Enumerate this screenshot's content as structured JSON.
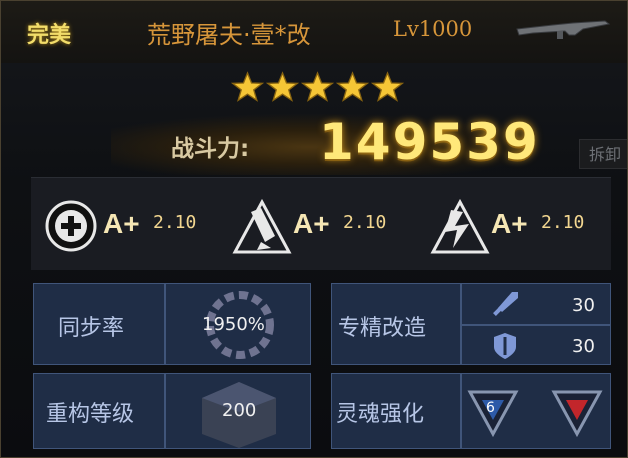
{
  "header": {
    "quality": "完美",
    "item_name": "荒野屠夫·壹*改",
    "level": "Lv1000"
  },
  "stars": {
    "count": 5,
    "max": 5,
    "color": "#f5c636"
  },
  "power": {
    "label": "战斗力:",
    "value": "149539"
  },
  "ghost_button": {
    "label": "拆卸"
  },
  "ratings": [
    {
      "icon": "plus-circle-icon",
      "grade": "A+",
      "value": "2.10"
    },
    {
      "icon": "rocket-up-icon",
      "grade": "A+",
      "value": "2.10"
    },
    {
      "icon": "lightning-triangle-icon",
      "grade": "A+",
      "value": "2.10"
    }
  ],
  "sync": {
    "label": "同步率",
    "value": "1950%"
  },
  "refine": {
    "label": "专精改造",
    "attack": "30",
    "defense": "30"
  },
  "rebuild": {
    "label": "重构等级",
    "value": "200"
  },
  "soul": {
    "label": "灵魂强化",
    "gem_value": "6"
  },
  "colors": {
    "accent_gold": "#f2dd6a",
    "name_orange": "#d7963a",
    "cell_blue": "#1f2d46"
  }
}
